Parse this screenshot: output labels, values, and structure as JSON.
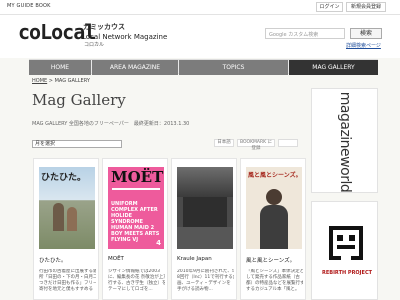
{
  "topbar": {
    "guide_label": "MY GUIDE BOOK",
    "login_label": "ログイン",
    "register_label": "新規会員登録"
  },
  "header": {
    "logo": "coLocal",
    "logo_kana": "カミッカウス",
    "logo_kana_sub": "コロカル",
    "tagline": "Local Network Magazine"
  },
  "search": {
    "placeholder": "Google カスタム検索",
    "button_label": "検索",
    "detail_link": "詳細検索ページ"
  },
  "nav": {
    "items": [
      "HOME",
      "AREA MAGAZINE",
      "TOPICS",
      "MAG GALLERY"
    ],
    "active": "MAG GALLERY"
  },
  "breadcrumb": {
    "home": "HOME",
    "sep": ">",
    "current": "MAG GALLERY"
  },
  "page": {
    "title": "Mag Gallery",
    "subtitle": "MAG GALLERY 全国各地のフリーペーパー　最終更新日：2013.1.30"
  },
  "filter": {
    "month_select": "月を選択",
    "tab1": "日本語",
    "tab2": "BOOKMARK に登録",
    "tab3": ""
  },
  "gallery": {
    "items": [
      {
        "label": "ひたひた。",
        "cover_title": "ひたひた。",
        "desc_lines": [
          "行田市の古着屋に出展する雑誌",
          "所「日田の・下の月・白月二",
          "つきだけ日田も作る」フリーペー",
          "寄付を地元と僕もすすめる"
        ]
      },
      {
        "label": "MOËT",
        "cover_title": "MOËT",
        "cover_sub": "UNIFORM COMPLEX AFTER HOLIDE SYNDROME HUMAN MAID 2 BOY MEETS ARTS FLYING VJ",
        "cover_num": "4",
        "desc_lines": [
          "ジザイン情報紙では2003",
          "に、編集長の花 奈敬治が上京",
          "行する、古き学生（独立）を",
          "テーマにしてロゴを..."
        ]
      },
      {
        "label": "Kraule Japan",
        "desc_lines": [
          "2010年9月に創刊された、年",
          "8回行（Inc）11で刊行する企",
          "画、ユーティ・デザインを",
          "手がける読み物..."
        ]
      },
      {
        "label": "風と風とシーンズ。",
        "cover_title": "風と風とシーンズ。",
        "desc_lines": [
          "「風とシーンズ」本体決定と",
          "して発売する作品家紙（古",
          "都）の特産品などを展覧行す",
          "するカジュアル本「風と。"
        ]
      }
    ]
  },
  "sidebar": {
    "banner1": "magazineworld",
    "banner2": "REBIRTH PROJECT"
  }
}
